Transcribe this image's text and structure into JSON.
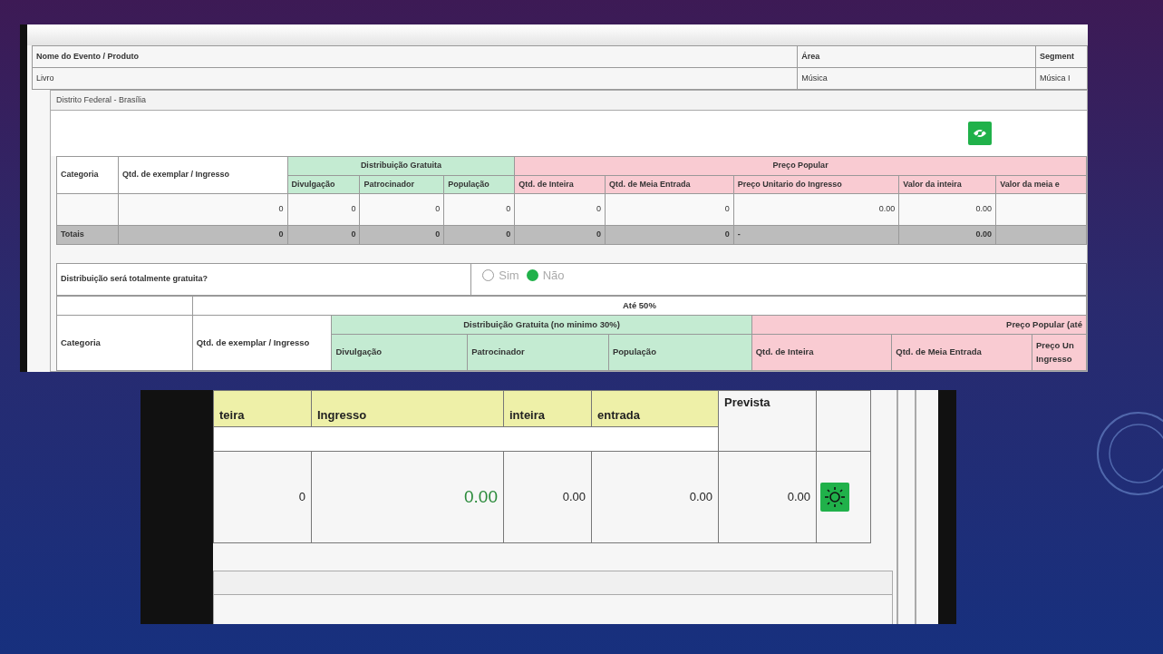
{
  "top_screenshot": {
    "event_table": {
      "columns": [
        "Nome do Evento / Produto",
        "Área",
        "Segment"
      ],
      "values": [
        "Livro",
        "Música",
        "Música I"
      ]
    },
    "region": "Distrito Federal - Brasília",
    "summary_table": {
      "group_headers": [
        {
          "label": "Distribuição Gratuita",
          "kind": "free"
        },
        {
          "label": "Preço Popular",
          "kind": "paid"
        }
      ],
      "columns": [
        {
          "label": "Categoria",
          "kind": "plain"
        },
        {
          "label": "Qtd. de exemplar / Ingresso",
          "kind": "plain"
        },
        {
          "label": "Divulgação",
          "kind": "free"
        },
        {
          "label": "Patrocinador",
          "kind": "free"
        },
        {
          "label": "População",
          "kind": "free"
        },
        {
          "label": "Qtd. de Inteira",
          "kind": "paid"
        },
        {
          "label": "Qtd. de Meia Entrada",
          "kind": "paid"
        },
        {
          "label": "Preço Unitario do Ingresso",
          "kind": "paid"
        },
        {
          "label": "Valor da inteira",
          "kind": "paid"
        },
        {
          "label": "Valor da meia e",
          "kind": "paid"
        }
      ],
      "row": [
        "0",
        "0",
        "0",
        "0",
        "0",
        "0",
        "0.00",
        "0.00"
      ],
      "totals": [
        "Totais",
        "0",
        "0",
        "0",
        "0",
        "0",
        "0",
        "-",
        "0.00"
      ]
    },
    "question": {
      "label": "Distribuição será totalmente gratuita?",
      "options": [
        {
          "label": "Sim",
          "selected": false
        },
        {
          "label": "Não",
          "selected": true
        }
      ]
    },
    "detail_table": {
      "caption": "Até 50%",
      "group_headers": [
        {
          "label": "Distribuição Gratuita (no minimo 30%)",
          "kind": "free"
        },
        {
          "label": "Preço Popular (até",
          "kind": "paid"
        }
      ],
      "columns": [
        {
          "label": "Categoria",
          "kind": "plain"
        },
        {
          "label": "Qtd. de exemplar / Ingresso",
          "kind": "plain"
        },
        {
          "label": "Divulgação",
          "kind": "free"
        },
        {
          "label": "Patrocinador",
          "kind": "free"
        },
        {
          "label": "População",
          "kind": "free"
        },
        {
          "label": "Qtd. de Inteira",
          "kind": "paid"
        },
        {
          "label": "Qtd. de Meia Entrada",
          "kind": "paid"
        },
        {
          "label": "Preço Un Ingresso",
          "kind": "paid"
        }
      ]
    }
  },
  "bottom_screenshot": {
    "columns": [
      {
        "label": "teira",
        "kind": "yellow"
      },
      {
        "label": "Ingresso",
        "kind": "yellow"
      },
      {
        "label": "inteira",
        "kind": "yellow"
      },
      {
        "label": "entrada",
        "kind": "yellow"
      },
      {
        "label": "Prevista",
        "kind": "plain"
      }
    ],
    "row": [
      {
        "value": "0",
        "kind": "text"
      },
      {
        "value": "0.00",
        "kind": "input"
      },
      {
        "value": "0.00",
        "kind": "text"
      },
      {
        "value": "0.00",
        "kind": "text"
      },
      {
        "value": "0.00",
        "kind": "text"
      }
    ]
  }
}
